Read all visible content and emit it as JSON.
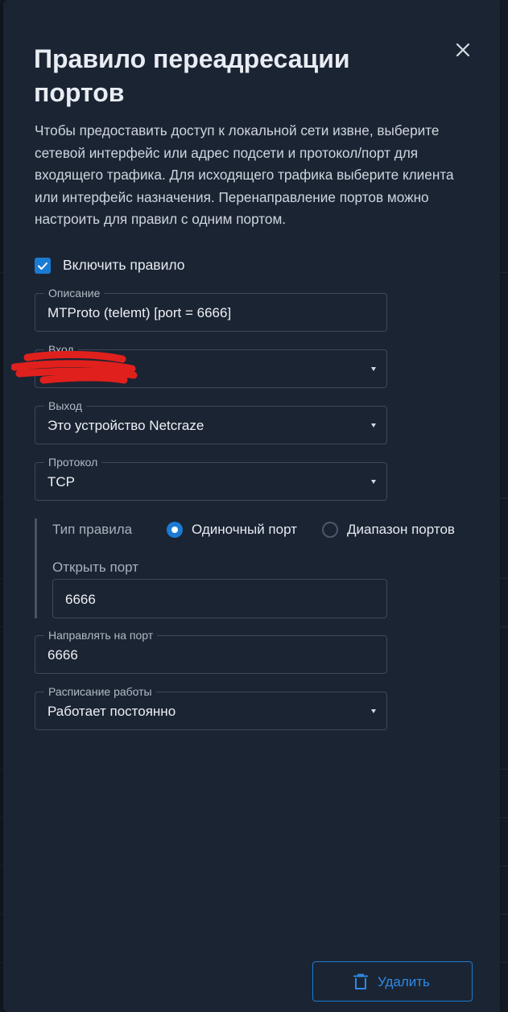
{
  "dialog": {
    "title": "Правило переадресации портов",
    "description": "Чтобы предоставить доступ к локальной сети извне, выберите сетевой интерфейс или адрес подсети и протокол/порт для входящего трафика. Для исходящего трафика выберите клиента или интерфейс назначения. Перенаправление портов можно настроить для правил с одним портом."
  },
  "enable_rule": {
    "label": "Включить правило",
    "checked": true
  },
  "fields": {
    "description": {
      "label": "Описание",
      "value": "MTProto (telemt) [port = 6666]"
    },
    "input": {
      "label": "Вход",
      "value": ""
    },
    "output": {
      "label": "Выход",
      "value": "Это устройство Netcraze"
    },
    "protocol": {
      "label": "Протокол",
      "value": "TCP"
    },
    "forward_port": {
      "label": "Направлять на порт",
      "value": "6666"
    },
    "schedule": {
      "label": "Расписание работы",
      "value": "Работает постоянно"
    }
  },
  "rule_type": {
    "label": "Тип правила",
    "options": [
      {
        "label": "Одиночный порт",
        "selected": true
      },
      {
        "label": "Диапазон портов",
        "selected": false
      }
    ],
    "open_port_label": "Открыть порт",
    "open_port_value": "6666"
  },
  "delete_button": {
    "label": "Удалить"
  },
  "colors": {
    "panel": "#1b2433",
    "accent": "#1a7bd3",
    "redaction": "#e0201c"
  }
}
